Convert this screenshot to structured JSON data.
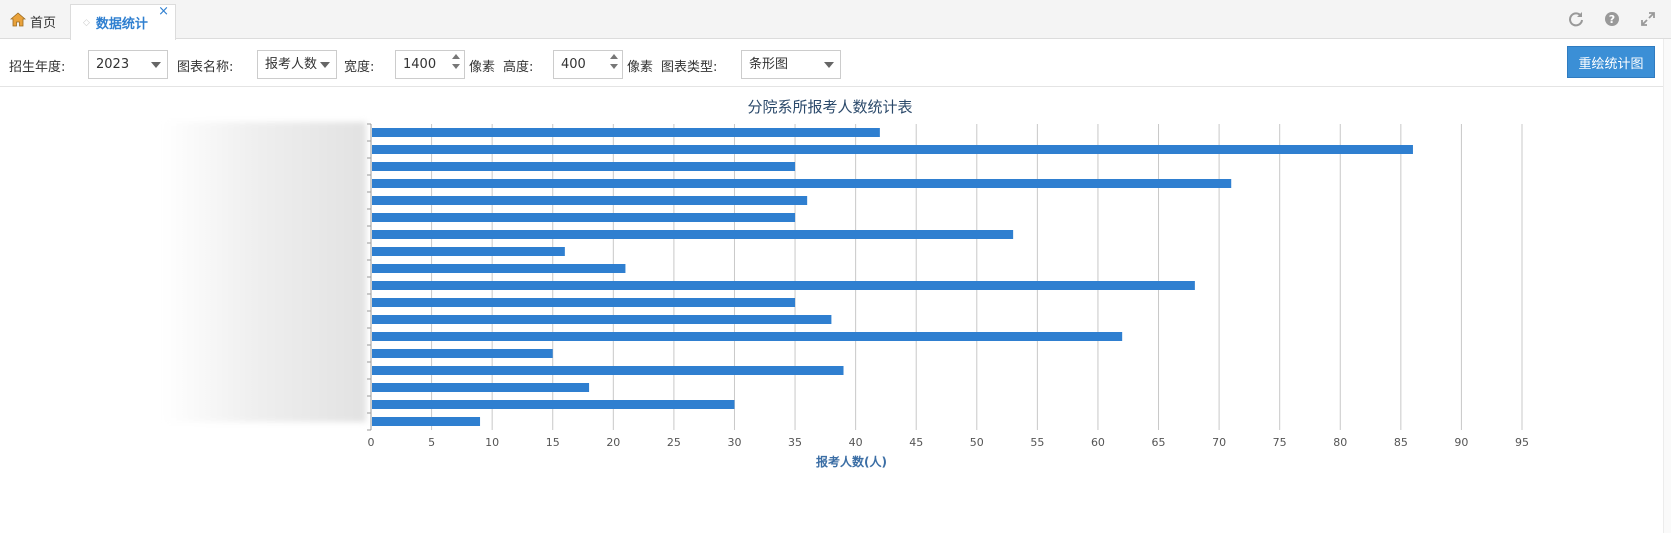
{
  "tabs": {
    "home_label": "首页",
    "active_label": "数据统计",
    "close_glyph": "×"
  },
  "toolbar": {
    "year_label": "招生年度:",
    "year_value": "2023",
    "chart_name_label": "图表名称:",
    "chart_name_value": "报考人数",
    "width_label": "宽度:",
    "width_value": "1400",
    "width_unit": "像素",
    "height_label": "高度:",
    "height_value": "400",
    "height_unit": "像素",
    "chart_type_label": "图表类型:",
    "chart_type_value": "条形图",
    "redraw_label": "重绘统计图"
  },
  "icons": {
    "home": "home-icon",
    "refresh": "refresh-icon",
    "help": "help-icon",
    "fullscreen": "fullscreen-icon"
  },
  "colors": {
    "accent": "#2f7fd0",
    "bar": "#2f7fd0",
    "button": "#3b8fd6",
    "title": "#2c4a6b"
  },
  "chart_data": {
    "type": "bar",
    "orientation": "horizontal",
    "title": "分院系所报考人数统计表",
    "xlabel": "报考人数(人)",
    "ylabel": "",
    "category_labels_visible": false,
    "values": [
      42,
      86,
      35,
      71,
      36,
      35,
      53,
      16,
      21,
      68,
      35,
      38,
      62,
      15,
      39,
      18,
      30,
      9
    ],
    "xlim": [
      0,
      95
    ],
    "xticks": [
      0,
      5,
      10,
      15,
      20,
      25,
      30,
      35,
      40,
      45,
      50,
      55,
      60,
      65,
      70,
      75,
      80,
      85,
      90,
      95
    ],
    "grid": true
  }
}
